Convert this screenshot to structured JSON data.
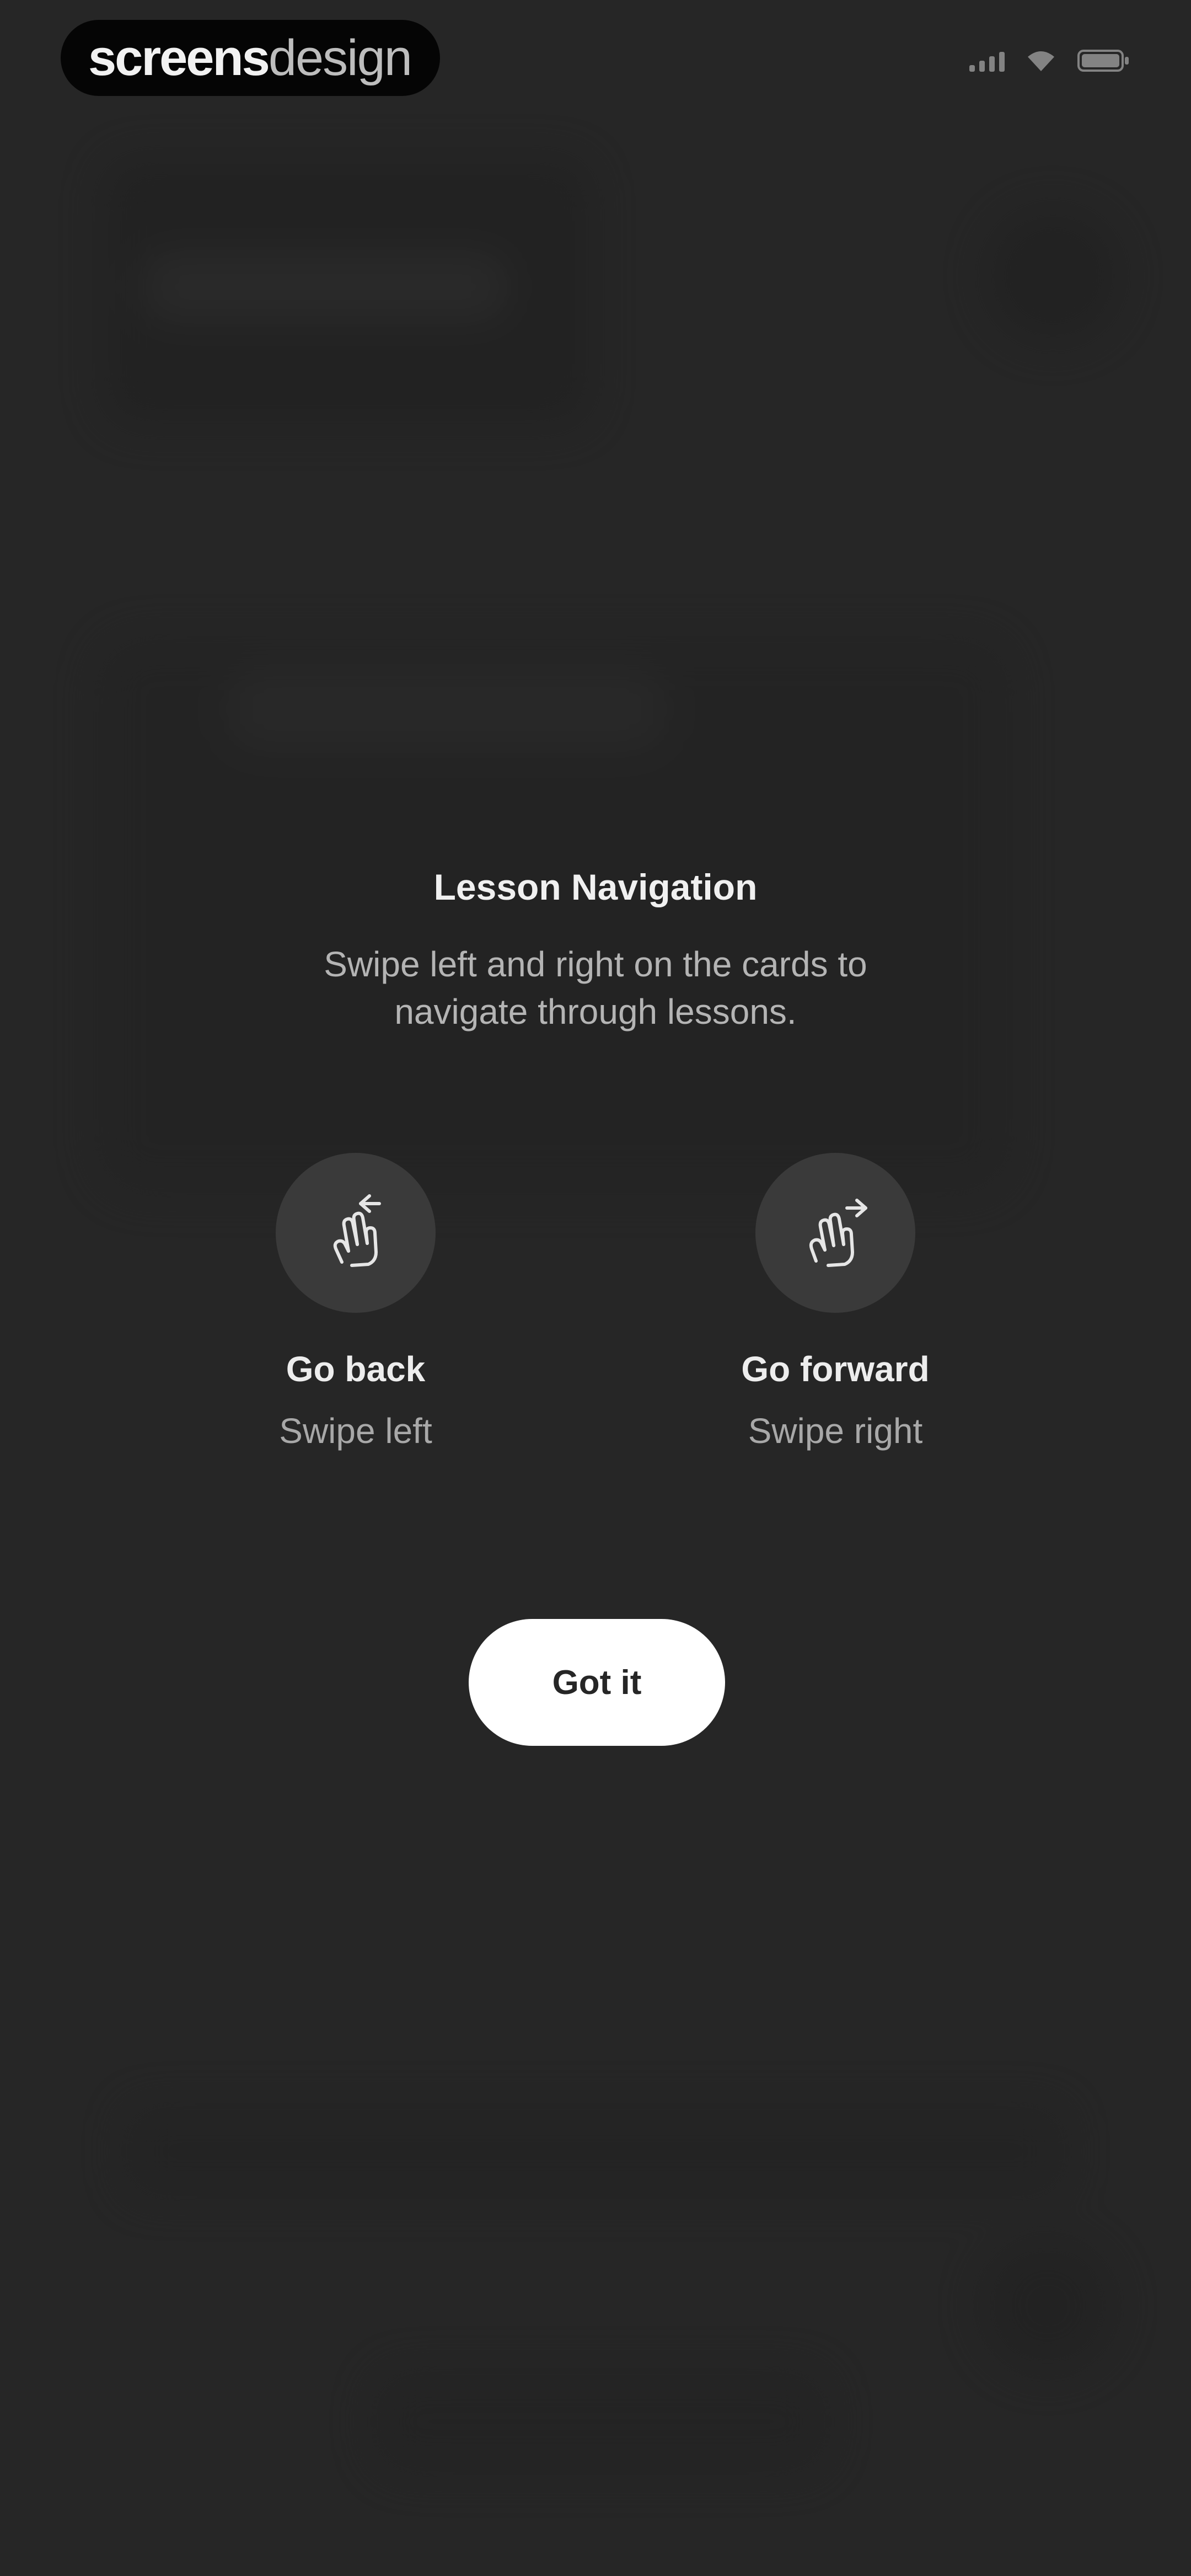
{
  "status_bar": {
    "brand_bold": "screens",
    "brand_light": "design",
    "icons": [
      "signal-icon",
      "wifi-icon",
      "battery-icon"
    ]
  },
  "overlay": {
    "title": "Lesson Navigation",
    "description": "Swipe left and right on the cards to navigate through lessons.",
    "gestures": [
      {
        "icon": "swipe-left-hand-icon",
        "label": "Go back",
        "hint": "Swipe left"
      },
      {
        "icon": "swipe-right-hand-icon",
        "label": "Go forward",
        "hint": "Swipe right"
      }
    ],
    "button_label": "Got it"
  },
  "colors": {
    "background": "#262626",
    "button": "#ffffff",
    "gesture_circle": "#3a3a3a"
  }
}
